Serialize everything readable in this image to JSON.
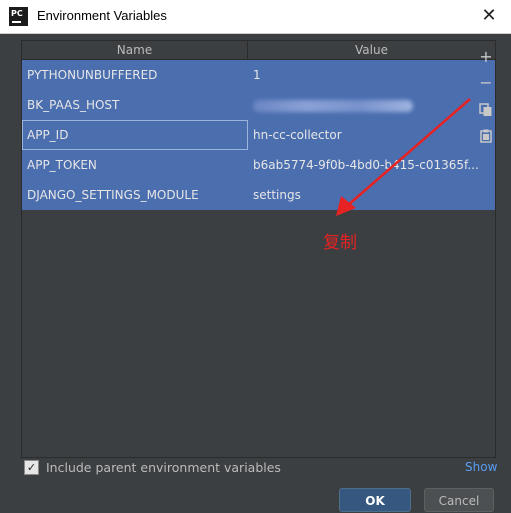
{
  "window": {
    "app_icon_text": "PC",
    "title": "Environment Variables",
    "close_glyph": "✕"
  },
  "table": {
    "columns": [
      "Name",
      "Value"
    ],
    "rows": [
      {
        "name": "PYTHONUNBUFFERED",
        "value": "1"
      },
      {
        "name": "BK_PAAS_HOST",
        "value": ""
      },
      {
        "name": "APP_ID",
        "value": "hn-cc-collector"
      },
      {
        "name": "APP_TOKEN",
        "value": "b6ab5774-9f0b-4bd0-b415-c01365f..."
      },
      {
        "name": "DJANGO_SETTINGS_MODULE",
        "value": "settings"
      }
    ]
  },
  "tools": {
    "add": "+",
    "remove": "−",
    "copy_icon": "copy-icon",
    "paste_icon": "paste-icon"
  },
  "footer": {
    "include_parent_label": "Include parent environment variables",
    "include_parent_checked": true,
    "show_link": "Show",
    "ok_label": "OK",
    "cancel_label": "Cancel"
  },
  "annotation": {
    "text": "复制",
    "color": "#e62222"
  },
  "colors": {
    "selection": "#4b6eaf",
    "background": "#3c3f41",
    "link": "#589df6",
    "ok_button": "#365880"
  }
}
